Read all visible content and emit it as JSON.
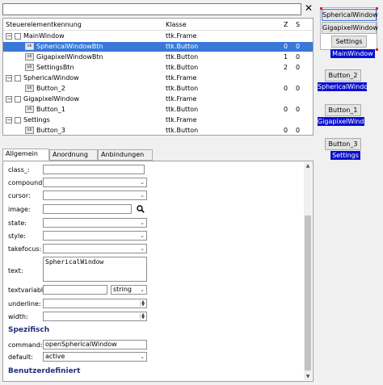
{
  "search": {
    "value": "",
    "placeholder": ""
  },
  "tree": {
    "columns": {
      "name": "Steuerelementkennung",
      "class": "Klasse",
      "z": "Z",
      "s": "S"
    },
    "rows": [
      {
        "name": "MainWindow",
        "class": "ttk.Frame",
        "z": "",
        "s": ""
      },
      {
        "name": "SphericalWindowBtn",
        "class": "ttk.Button",
        "z": "0",
        "s": "0"
      },
      {
        "name": "GigapixelWindowBtn",
        "class": "ttk.Button",
        "z": "1",
        "s": "0"
      },
      {
        "name": "SettingsBtn",
        "class": "ttk.Button",
        "z": "2",
        "s": "0"
      },
      {
        "name": "SphericalWindow",
        "class": "ttk.Frame",
        "z": "",
        "s": ""
      },
      {
        "name": "Button_2",
        "class": "ttk.Button",
        "z": "0",
        "s": "0"
      },
      {
        "name": "GigapixelWindow",
        "class": "ttk.Frame",
        "z": "",
        "s": ""
      },
      {
        "name": "Button_1",
        "class": "ttk.Button",
        "z": "0",
        "s": "0"
      },
      {
        "name": "Settings",
        "class": "ttk.Frame",
        "z": "",
        "s": ""
      },
      {
        "name": "Button_3",
        "class": "ttk.Button",
        "z": "0",
        "s": "0"
      }
    ]
  },
  "tabs": [
    "Allgemein",
    "Anordnung",
    "Anbindungen"
  ],
  "properties": {
    "class_label": "class_:",
    "compound_label": "compound:",
    "cursor_label": "cursor:",
    "image_label": "image:",
    "state_label": "state:",
    "style_label": "style:",
    "takefocus_label": "takefocus:",
    "text_label": "text:",
    "text_value": "SphericalWindow",
    "textvariable_label": "textvariable:",
    "textvariable_type": "string",
    "underline_label": "underline:",
    "width_label": "width:",
    "section_specific": "Spezifisch",
    "command_label": "command:",
    "command_value": "openSphericalWindow",
    "default_label": "default:",
    "default_value": "active",
    "section_custom": "Benutzerdefiniert"
  },
  "preview": {
    "main_buttons": [
      "SphericalWindow",
      "GigapixelWindow",
      "Settings"
    ],
    "main_label": "MainWindow",
    "frames": [
      {
        "button": "Button_2",
        "label": "SphericalWindow"
      },
      {
        "button": "Button_1",
        "label": "GigapixelWindow"
      },
      {
        "button": "Button_3",
        "label": "Settings"
      }
    ]
  },
  "colors": {
    "selection": "#3a78d8",
    "label_bg": "#0a0fcf",
    "section_title": "#1f2f7a",
    "handle": "#e02020"
  },
  "icons": {
    "close": "close-icon",
    "search": "search-icon"
  }
}
